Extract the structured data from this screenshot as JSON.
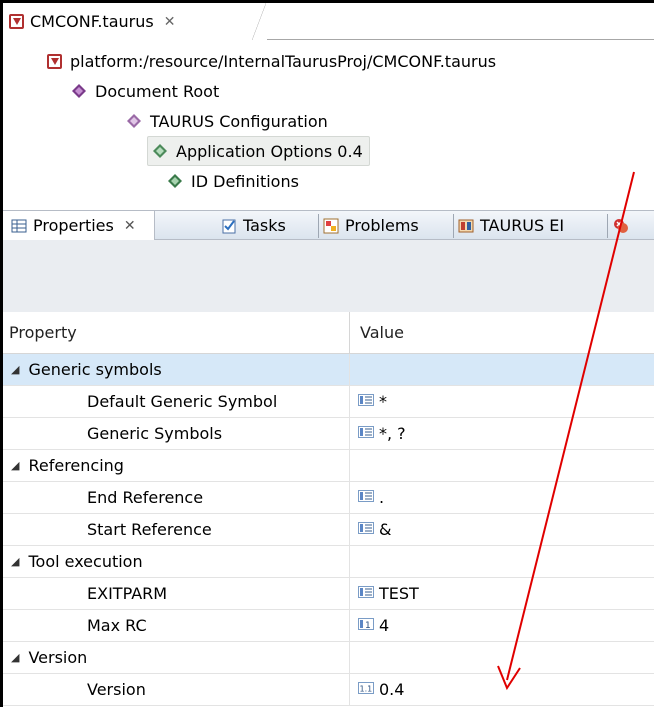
{
  "editor": {
    "tab_title": "CMCONF.taurus",
    "tab_close": "✕",
    "tree": {
      "resource": "platform:/resource/InternalTaurusProj/CMCONF.taurus",
      "document_root": "Document Root",
      "configuration": "TAURUS Configuration",
      "application_options": "Application Options 0.4",
      "id_definitions": "ID Definitions"
    }
  },
  "views": {
    "properties_tab": "Properties",
    "tab_close": "✕",
    "tasks_tab": "Tasks",
    "problems_tab": "Problems",
    "taurus_tab": "TAURUS EI"
  },
  "table": {
    "header_property": "Property",
    "header_value": "Value",
    "sections": [
      {
        "name": "Generic symbols",
        "rows": [
          {
            "property": "Default Generic Symbol",
            "value": "*",
            "icon": "list-icon"
          },
          {
            "property": "Generic Symbols",
            "value": "*, ?",
            "icon": "list-icon"
          }
        ]
      },
      {
        "name": "Referencing",
        "rows": [
          {
            "property": "End Reference",
            "value": ".",
            "icon": "list-icon"
          },
          {
            "property": "Start Reference",
            "value": "&",
            "icon": "list-icon"
          }
        ]
      },
      {
        "name": "Tool execution",
        "rows": [
          {
            "property": "EXITPARM",
            "value": "TEST",
            "icon": "list-icon"
          },
          {
            "property": "Max RC",
            "value": "4",
            "icon": "integer-icon"
          }
        ]
      },
      {
        "name": "Version",
        "rows": [
          {
            "property": "Version",
            "value": "0.4",
            "icon": "decimal-icon"
          }
        ]
      }
    ]
  },
  "colors": {
    "annotation_arrow": "#e00000",
    "selection": "#d6e8f8",
    "tab_gradient_top": "#f3f6fa",
    "tab_gradient_bottom": "#dbe4ee"
  }
}
